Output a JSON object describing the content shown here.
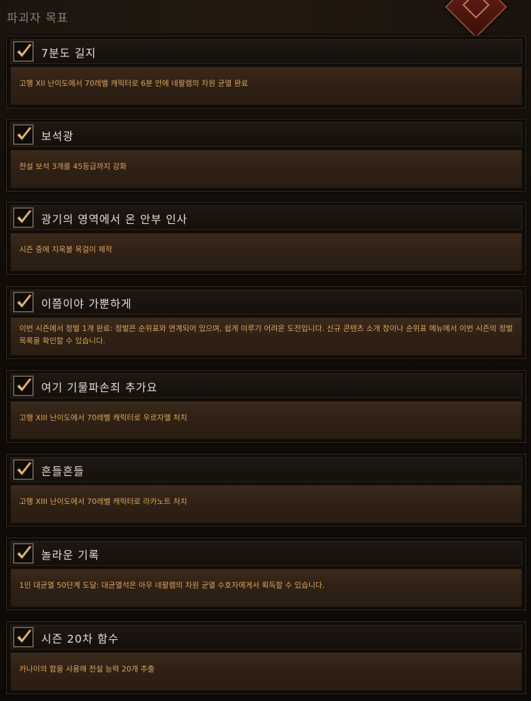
{
  "header": {
    "title": "파괴자 목표",
    "emblem_icon": "season-emblem-icon"
  },
  "colors": {
    "title_text": "#e3dcd2",
    "description_text": "#d9a45e",
    "checkmark": "#e8c48a"
  },
  "objectives": [
    {
      "title": "7분도 길지",
      "description": "고행 XII 난이도에서 70레벨 캐릭터로 6분 안에 네팔렘의 차원 균열 완료",
      "completed": true
    },
    {
      "title": "보석광",
      "description": "전설 보석 3개를 45등급까지 강화",
      "completed": true
    },
    {
      "title": "광기의 영역에서 온 안부 인사",
      "description": "시즌 중에 지옥불 목걸이 제작",
      "completed": true
    },
    {
      "title": "이쯤이야 가뿐하게",
      "description": "이번 시즌에서 정벌 1개 완료: 정벌은 순위표와 연계되어 있으며, 쉽게 이루기 어려운 도전입니다. 신규 콘텐츠 소개 창이나 순위표 메뉴에서 이번 시즌의 정벌 목록을 확인할 수 있습니다.",
      "completed": true
    },
    {
      "title": "여기 기물파손죄 추가요",
      "description": "고행 XIII 난이도에서 70레벨 캐릭터로 우르자엘 처치",
      "completed": true
    },
    {
      "title": "흔들흔들",
      "description": "고행 XIII 난이도에서 70레벨 캐릭터로 라카노트 처치",
      "completed": true
    },
    {
      "title": "놀라운 기록",
      "description": "1인 대균열 50단계 도달: 대균열석은 아무 네팔렘의 차원 균열 수호자에게서 획득할 수 있습니다.",
      "completed": true
    },
    {
      "title": "시즌 20차 함수",
      "description": "카나이의 함을 사용해 전설 능력 20개 추출",
      "completed": true
    }
  ]
}
